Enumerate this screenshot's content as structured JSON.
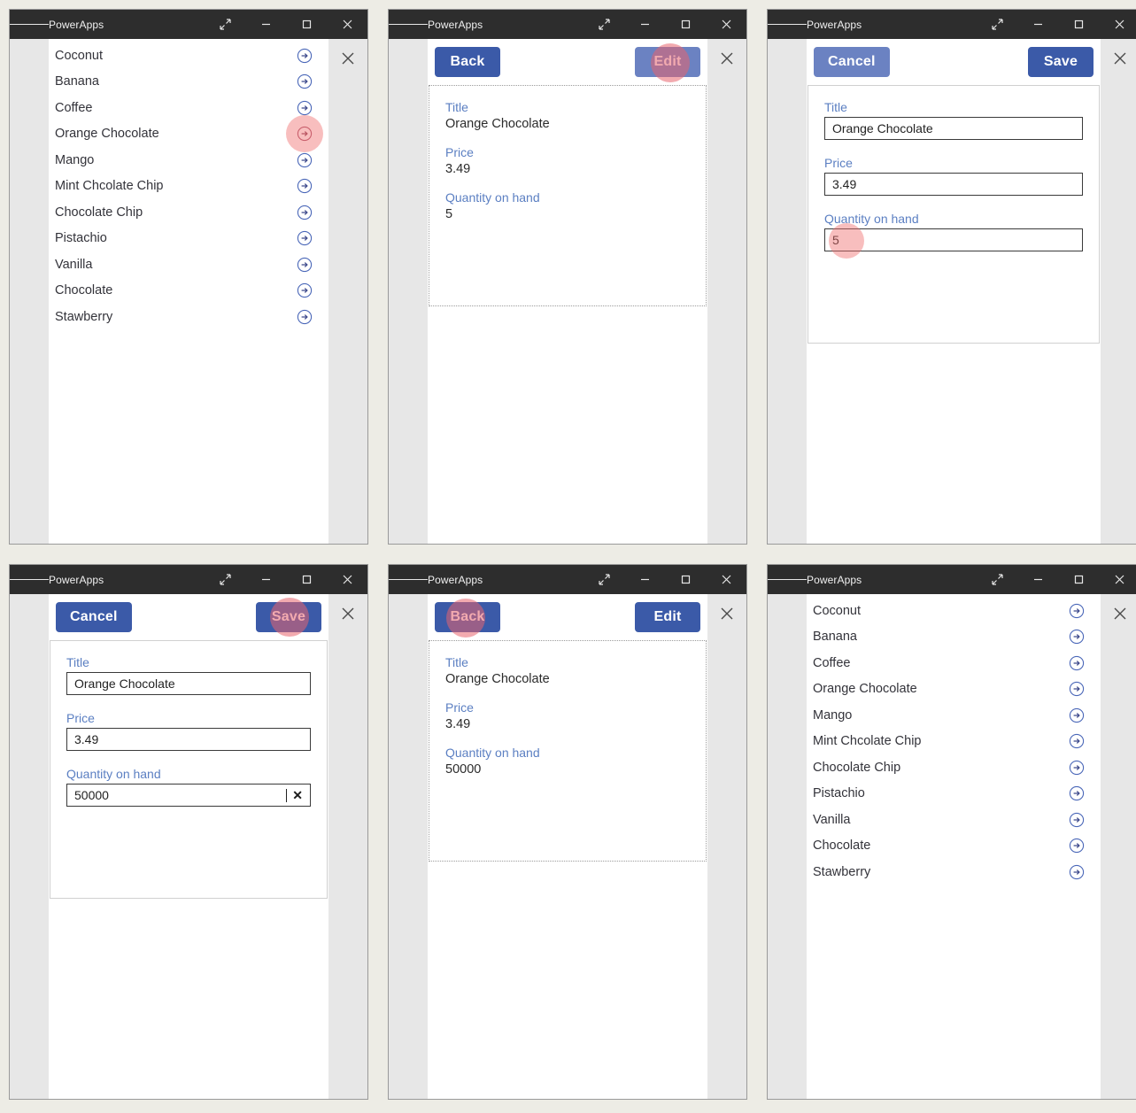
{
  "window": {
    "title": "PowerApps",
    "controls": {
      "menu": "hamburger-menu",
      "expand": "expand-icon",
      "minimize": "minimize-icon",
      "maximize": "maximize-icon",
      "close": "close-icon"
    },
    "app_close": "app-close-icon"
  },
  "gallery": {
    "items": [
      "Coconut",
      "Banana",
      "Coffee",
      "Orange Chocolate",
      "Mango",
      "Mint Chcolate Chip",
      "Chocolate Chip",
      "Pistachio",
      "Vanilla",
      "Chocolate",
      "Stawberry"
    ],
    "arrow_icon": "chevron-circle-right-icon"
  },
  "buttons": {
    "back": "Back",
    "edit": "Edit",
    "cancel": "Cancel",
    "save": "Save"
  },
  "form": {
    "labels": {
      "title": "Title",
      "price": "Price",
      "quantity": "Quantity on hand"
    },
    "before": {
      "title": "Orange Chocolate",
      "price": "3.49",
      "quantity": "5"
    },
    "editing": {
      "title": "Orange Chocolate",
      "price": "3.49",
      "quantity": "5"
    },
    "typed": {
      "title": "Orange Chocolate",
      "price": "3.49",
      "quantity": "50000"
    },
    "after": {
      "title": "Orange Chocolate",
      "price": "3.49",
      "quantity": "50000"
    },
    "clear_icon": "clear-x-icon"
  },
  "colors": {
    "button_primary": "#3b5aa8",
    "button_hover": "#6b82c2",
    "label_blue": "#5b7fc2",
    "titlebar": "#2d2d2d",
    "cursor_halo": "#f06e6e",
    "page_background": "#edece5"
  }
}
